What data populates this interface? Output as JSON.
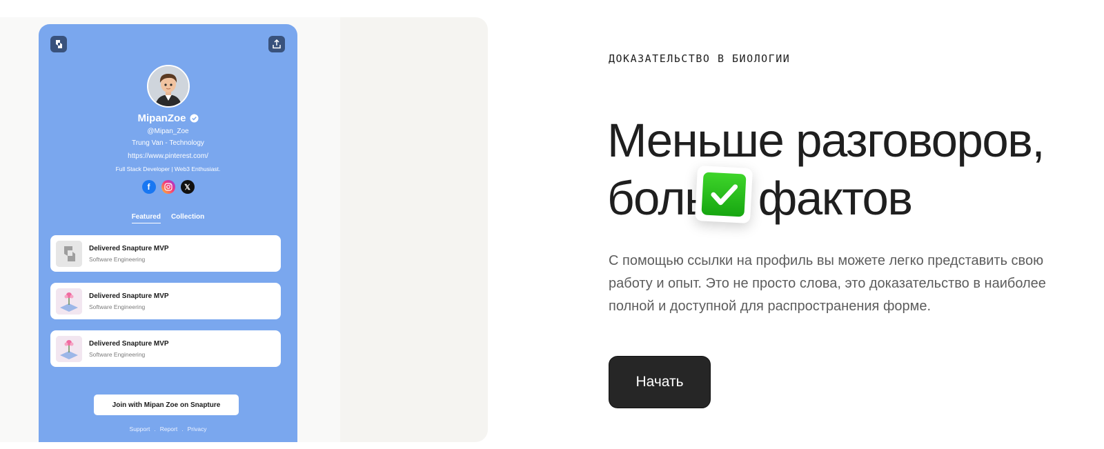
{
  "profile": {
    "name": "MipanZoe",
    "handle": "@Mipan_Zoe",
    "subtitle": "Trung Van - Technology",
    "url": "https://www.pinterest.com/",
    "bio": "Full Stack Developer | Web3 Enthusiast.",
    "socials": [
      "facebook-icon",
      "instagram-icon",
      "x-icon"
    ]
  },
  "tabs": [
    {
      "label": "Featured",
      "active": true
    },
    {
      "label": "Collection",
      "active": false
    }
  ],
  "cards": [
    {
      "title": "Delivered Snapture MVP",
      "subtitle": "Software Engineering",
      "thumb": "snapture-logo"
    },
    {
      "title": "Delivered Snapture MVP",
      "subtitle": "Software Engineering",
      "thumb": "artwork"
    },
    {
      "title": "Delivered Snapture MVP",
      "subtitle": "Software Engineering",
      "thumb": "artwork"
    }
  ],
  "join_button": "Join with Mipan Zoe on Snapture",
  "footer_links": [
    "Support",
    "Report",
    "Privacy"
  ],
  "eyebrow": "ДОКАЗАТЕЛЬСТВО В БИОЛОГИИ",
  "headline": {
    "line1": "Меньше разговоров,",
    "line2_prefix": "боль",
    "line2_suffix": "фактов"
  },
  "paragraph": "С помощью ссылки на профиль вы можете легко представить свою работу и опыт. Это не просто слова, это доказательство в наиболее полной и доступной для распространения форме.",
  "cta": "Начать",
  "colors": {
    "phone_bg": "#7aa7ee",
    "cta_bg": "#262626",
    "check_green": "#1fb316"
  }
}
